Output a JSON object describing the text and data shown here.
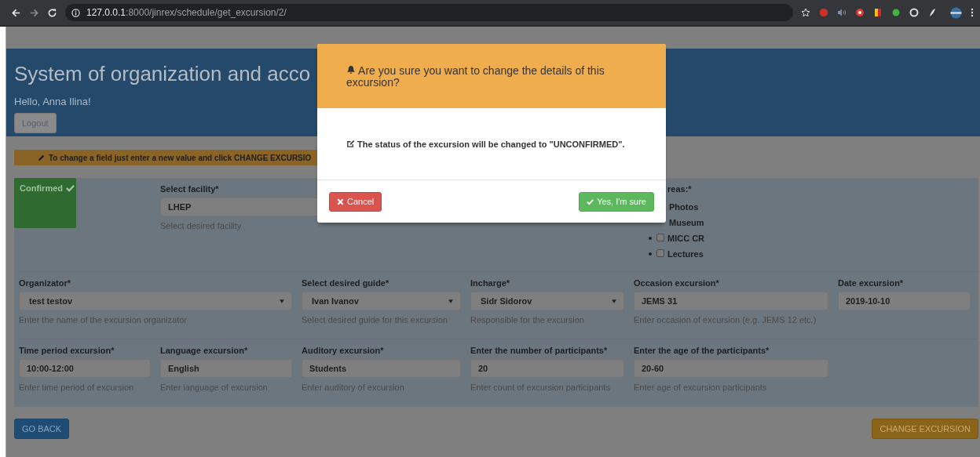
{
  "browser": {
    "url_host": "127.0.0.1",
    "url_path": ":8000/jinrex/schedule/get_excursion/2/"
  },
  "header": {
    "title": "System of organization and acco",
    "greeting": "Hello, Anna Ilina!",
    "logout": "Logout"
  },
  "notice": "To change a field just enter a new value and click CHANGE EXCURSIO",
  "status": {
    "label": "Confirmed",
    "kind": "confirmed"
  },
  "facility": {
    "label": "Select facility*",
    "value": "LHEP",
    "help": "Select desired facility"
  },
  "areas": {
    "label": "reas:*",
    "items": [
      {
        "label": "Photos"
      },
      {
        "label": "Museum"
      },
      {
        "label": "MICC CR",
        "checked": false
      },
      {
        "label": "Lectures",
        "checked": false
      }
    ]
  },
  "rows": [
    [
      {
        "label": "Organizator*",
        "value": "test testov",
        "help": "Enter the name of the excursion organizator",
        "kind": "select"
      },
      {
        "label": "Select desired guide*",
        "value": "Ivan Ivanov",
        "help": "Select desired guide for this excursion",
        "kind": "select"
      },
      {
        "label": "Incharge*",
        "value": "Sidr Sidorov",
        "help": "Responsible for the excursion",
        "kind": "select"
      },
      {
        "label": "Occasion excursion*",
        "value": "JEMS 31",
        "help": "Enter occasion of excursion (e.g. JEMS 12 etc.)",
        "kind": "text"
      },
      {
        "label": "Date excursion*",
        "value": "2019-10-10",
        "kind": "text"
      }
    ],
    [
      {
        "label": "Time period excursion*",
        "value": "10:00-12:00",
        "help": "Enter time period of excursion",
        "kind": "text"
      },
      {
        "label": "Language excursion*",
        "value": "English",
        "help": "Enter language of excursion",
        "kind": "text"
      },
      {
        "label": "Auditory excursion*",
        "value": "Students",
        "help": "Enter auditory of excursion",
        "kind": "text"
      },
      {
        "label": "Enter the number of participants*",
        "value": "20",
        "help": "Enter count of excursion participants",
        "kind": "text"
      },
      {
        "label": "Enter the age of the participants*",
        "value": "20-60",
        "help": "Enter age of excursion participants",
        "kind": "text"
      }
    ]
  ],
  "buttons": {
    "back": "GO BACK",
    "change": "CHANGE EXCURSION"
  },
  "modal": {
    "title": "Are you sure you want to change the details of this excursion?",
    "message": "The status of the excursion will be changed to \"UNCONFIRMED\".",
    "cancel": "Cancel",
    "confirm": "Yes, I'm sure"
  }
}
